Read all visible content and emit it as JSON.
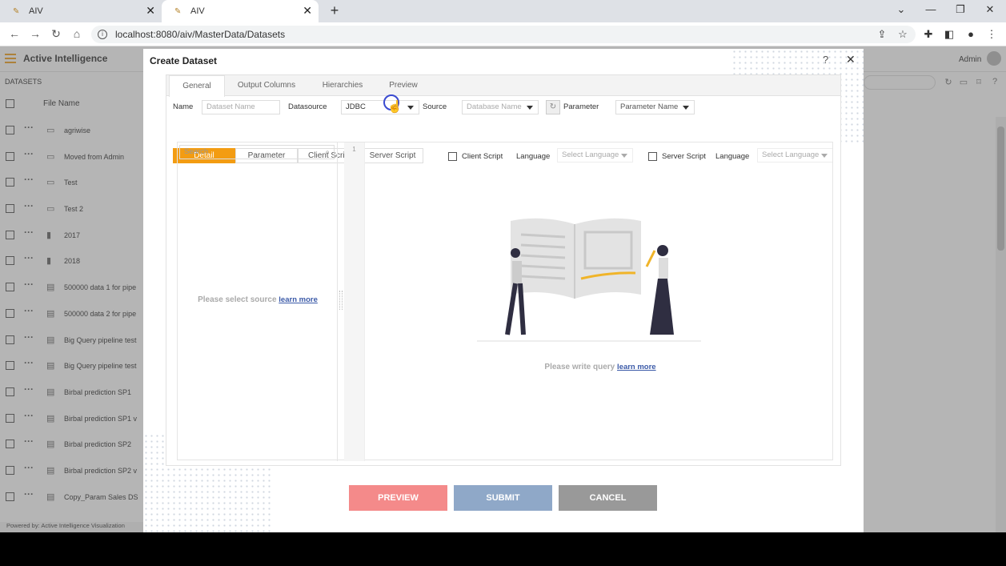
{
  "browser": {
    "tabs": [
      {
        "title": "AIV"
      },
      {
        "title": "AIV"
      }
    ],
    "url": "localhost:8080/aiv/MasterData/Datasets"
  },
  "app": {
    "brand": "Active Intelligence",
    "user": "Admin",
    "section_label": "DATASETS",
    "column_file_name": "File Name",
    "files": [
      {
        "name": "agriwise",
        "icon": "folder-icon"
      },
      {
        "name": "Moved from Admin",
        "icon": "folder-icon"
      },
      {
        "name": "Test",
        "icon": "folder-icon"
      },
      {
        "name": "Test 2",
        "icon": "folder-icon"
      },
      {
        "name": "2017",
        "icon": "dataset-icon"
      },
      {
        "name": "2018",
        "icon": "dataset-icon"
      },
      {
        "name": "500000 data 1 for pipe",
        "icon": "server-icon"
      },
      {
        "name": "500000 data 2 for pipe",
        "icon": "server-icon"
      },
      {
        "name": "Big Query pipeline test",
        "icon": "server-icon"
      },
      {
        "name": "Big Query pipeline test",
        "icon": "server-icon"
      },
      {
        "name": "Birbal prediction SP1",
        "icon": "server-icon"
      },
      {
        "name": "Birbal prediction SP1 v",
        "icon": "server-icon"
      },
      {
        "name": "Birbal prediction SP2",
        "icon": "server-icon"
      },
      {
        "name": "Birbal prediction SP2 v",
        "icon": "server-icon"
      },
      {
        "name": "Copy_Param Sales DS",
        "icon": "server-icon"
      }
    ],
    "powered_by": "Powered by: Active Intelligence Visualization"
  },
  "modal": {
    "title": "Create Dataset",
    "tabs": [
      "General",
      "Output Columns",
      "Hierarchies",
      "Preview"
    ],
    "name_label": "Name",
    "name_placeholder": "Dataset Name",
    "datasource_label": "Datasource",
    "datasource_value": "JDBC",
    "source_label": "Source",
    "source_placeholder": "Database Name",
    "parameter_label": "Parameter",
    "parameter_placeholder": "Parameter Name",
    "subtabs": [
      "Detail",
      "Parameter",
      "Client Script",
      "Server Script"
    ],
    "client_script_label": "Client Script",
    "server_script_label": "Server Script",
    "language_label": "Language",
    "language_placeholder": "Select Language",
    "search_placeholder": "Search",
    "select_source_text": "Please select source",
    "learn_more": "learn more",
    "line_number": "1",
    "write_query_text": "Please write query",
    "buttons": {
      "preview": "PREVIEW",
      "submit": "SUBMIT",
      "cancel": "CANCEL"
    },
    "colors": {
      "accent": "#f39c12",
      "preview": "#f48a8a",
      "submit": "#8fa8c8",
      "cancel": "#999999"
    }
  }
}
